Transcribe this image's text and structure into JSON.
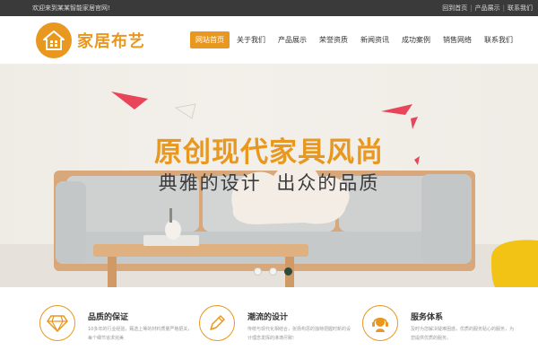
{
  "topbar": {
    "welcome": "欢迎来到某某智能家居官网!",
    "links": [
      "回到首页",
      "产品展示",
      "联系我们"
    ],
    "separator": "|"
  },
  "header": {
    "logo_icon": "house-icon",
    "logo_text": "家居布艺",
    "nav": [
      "网站首页",
      "关于我们",
      "产品展示",
      "荣誉资质",
      "新闻资讯",
      "成功案例",
      "销售网络",
      "联系我们"
    ],
    "active_index": 0
  },
  "banner": {
    "title": "原创现代家具风尚",
    "subtitle": "典雅的设计  出众的品质",
    "slides": 3,
    "active_slide": 2
  },
  "features": [
    {
      "icon": "diamond-icon",
      "title": "品质的保证",
      "desc": "10多年的行业经验，甄选上等的材料质量严格把关，每个细节追求完美"
    },
    {
      "icon": "pencil-icon",
      "title": "潮流的设计",
      "desc": "传统与现代化相结合，张扬构思的独特把握时新的设计理念发挥的淋漓尽致!"
    },
    {
      "icon": "support-agent-icon",
      "title": "服务体系",
      "desc": "及时为您解决疑难困惑，优质的服务贴心的服务，为您提供优质的服务。"
    }
  ],
  "colors": {
    "accent": "#e8971f",
    "topbar_bg": "#3a3a3a",
    "active_dot": "#2b4a3c",
    "paper_plane": "#e8455a"
  }
}
